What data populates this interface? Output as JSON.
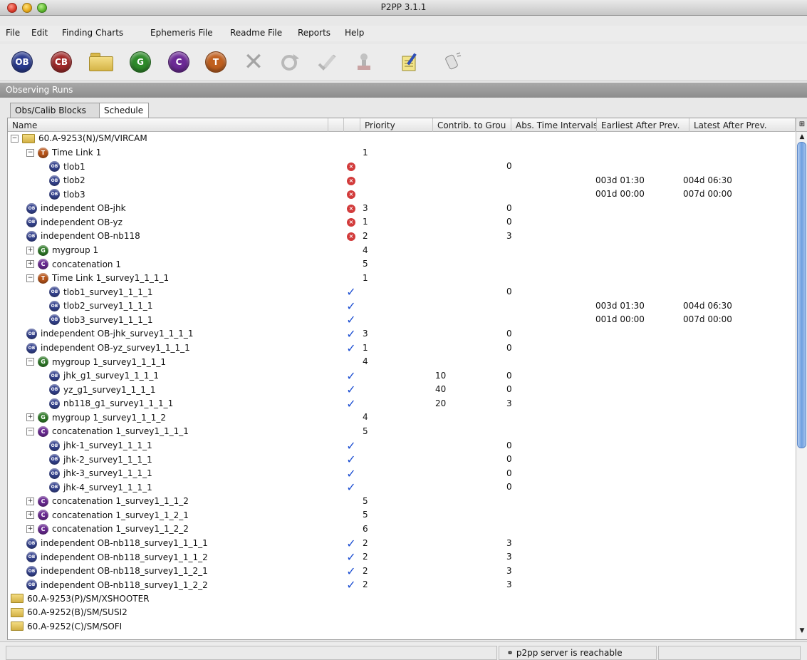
{
  "window": {
    "title": "P2PP 3.1.1"
  },
  "menu": [
    "File",
    "Edit",
    "Finding Charts",
    "Ephemeris File",
    "Readme File",
    "Reports",
    "Help"
  ],
  "toolbar": {
    "ob_label": "OB",
    "cb_label": "CB",
    "g_label": "G",
    "c_label": "C",
    "t_label": "T"
  },
  "panel": {
    "title": "Observing Runs"
  },
  "tabs": [
    "Obs/Calib Blocks",
    "Schedule"
  ],
  "columns": [
    "Name",
    "Priority",
    "Contrib. to Grou",
    "Abs. Time Intervals",
    "Earliest After Prev.",
    "Latest After Prev."
  ],
  "icon_badges": {
    "ob": "OB",
    "t": "T",
    "g": "G",
    "c": "C"
  },
  "status_glyphs": {
    "error": "×",
    "ok": "✓"
  },
  "rows": [
    {
      "depth": 0,
      "exp": "-",
      "icon": "folder",
      "name": "60.A-9253(N)/SM/VIRCAM",
      "status": "",
      "prio": "",
      "contrib": "",
      "abs": "",
      "earliest": "",
      "latest": ""
    },
    {
      "depth": 1,
      "exp": "-",
      "icon": "t",
      "name": "Time Link 1",
      "status": "",
      "prio": "1",
      "contrib": "",
      "abs": "",
      "earliest": "",
      "latest": ""
    },
    {
      "depth": 2,
      "exp": "",
      "icon": "ob",
      "name": "tlob1",
      "status": "error",
      "prio": "",
      "contrib": "",
      "abs": "0",
      "earliest": "",
      "latest": ""
    },
    {
      "depth": 2,
      "exp": "",
      "icon": "ob",
      "name": "tlob2",
      "status": "error",
      "prio": "",
      "contrib": "",
      "abs": "",
      "earliest": "003d 01:30",
      "latest": "004d 06:30"
    },
    {
      "depth": 2,
      "exp": "",
      "icon": "ob",
      "name": "tlob3",
      "status": "error",
      "prio": "",
      "contrib": "",
      "abs": "",
      "earliest": "001d 00:00",
      "latest": "007d 00:00"
    },
    {
      "depth": 1,
      "exp": "",
      "icon": "ob",
      "name": "independent OB-jhk",
      "status": "error",
      "prio": "3",
      "contrib": "",
      "abs": "0",
      "earliest": "",
      "latest": ""
    },
    {
      "depth": 1,
      "exp": "",
      "icon": "ob",
      "name": "independent OB-yz",
      "status": "error",
      "prio": "1",
      "contrib": "",
      "abs": "0",
      "earliest": "",
      "latest": ""
    },
    {
      "depth": 1,
      "exp": "",
      "icon": "ob",
      "name": "independent OB-nb118",
      "status": "error",
      "prio": "2",
      "contrib": "",
      "abs": "3",
      "earliest": "",
      "latest": ""
    },
    {
      "depth": 1,
      "exp": "+",
      "icon": "g",
      "name": "mygroup 1",
      "status": "",
      "prio": "4",
      "contrib": "",
      "abs": "",
      "earliest": "",
      "latest": ""
    },
    {
      "depth": 1,
      "exp": "+",
      "icon": "c",
      "name": "concatenation 1",
      "status": "",
      "prio": "5",
      "contrib": "",
      "abs": "",
      "earliest": "",
      "latest": ""
    },
    {
      "depth": 1,
      "exp": "-",
      "icon": "t",
      "name": "Time Link 1_survey1_1_1_1",
      "status": "",
      "prio": "1",
      "contrib": "",
      "abs": "",
      "earliest": "",
      "latest": ""
    },
    {
      "depth": 2,
      "exp": "",
      "icon": "ob",
      "name": "tlob1_survey1_1_1_1",
      "status": "ok",
      "prio": "",
      "contrib": "",
      "abs": "0",
      "earliest": "",
      "latest": ""
    },
    {
      "depth": 2,
      "exp": "",
      "icon": "ob",
      "name": "tlob2_survey1_1_1_1",
      "status": "ok",
      "prio": "",
      "contrib": "",
      "abs": "",
      "earliest": "003d 01:30",
      "latest": "004d 06:30"
    },
    {
      "depth": 2,
      "exp": "",
      "icon": "ob",
      "name": "tlob3_survey1_1_1_1",
      "status": "ok",
      "prio": "",
      "contrib": "",
      "abs": "",
      "earliest": "001d 00:00",
      "latest": "007d 00:00"
    },
    {
      "depth": 1,
      "exp": "",
      "icon": "ob",
      "name": "independent OB-jhk_survey1_1_1_1",
      "status": "ok",
      "prio": "3",
      "contrib": "",
      "abs": "0",
      "earliest": "",
      "latest": ""
    },
    {
      "depth": 1,
      "exp": "",
      "icon": "ob",
      "name": "independent OB-yz_survey1_1_1_1",
      "status": "ok",
      "prio": "1",
      "contrib": "",
      "abs": "0",
      "earliest": "",
      "latest": ""
    },
    {
      "depth": 1,
      "exp": "-",
      "icon": "g",
      "name": "mygroup 1_survey1_1_1_1",
      "status": "",
      "prio": "4",
      "contrib": "",
      "abs": "",
      "earliest": "",
      "latest": ""
    },
    {
      "depth": 2,
      "exp": "",
      "icon": "ob",
      "name": "jhk_g1_survey1_1_1_1",
      "status": "ok",
      "prio": "",
      "contrib": "10",
      "abs": "0",
      "earliest": "",
      "latest": ""
    },
    {
      "depth": 2,
      "exp": "",
      "icon": "ob",
      "name": "yz_g1_survey1_1_1_1",
      "status": "ok",
      "prio": "",
      "contrib": "40",
      "abs": "0",
      "earliest": "",
      "latest": ""
    },
    {
      "depth": 2,
      "exp": "",
      "icon": "ob",
      "name": "nb118_g1_survey1_1_1_1",
      "status": "ok",
      "prio": "",
      "contrib": "20",
      "abs": "3",
      "earliest": "",
      "latest": ""
    },
    {
      "depth": 1,
      "exp": "+",
      "icon": "g",
      "name": "mygroup 1_survey1_1_1_2",
      "status": "",
      "prio": "4",
      "contrib": "",
      "abs": "",
      "earliest": "",
      "latest": ""
    },
    {
      "depth": 1,
      "exp": "-",
      "icon": "c",
      "name": "concatenation 1_survey1_1_1_1",
      "status": "",
      "prio": "5",
      "contrib": "",
      "abs": "",
      "earliest": "",
      "latest": ""
    },
    {
      "depth": 2,
      "exp": "",
      "icon": "ob",
      "name": "jhk-1_survey1_1_1_1",
      "status": "ok",
      "prio": "",
      "contrib": "",
      "abs": "0",
      "earliest": "",
      "latest": ""
    },
    {
      "depth": 2,
      "exp": "",
      "icon": "ob",
      "name": "jhk-2_survey1_1_1_1",
      "status": "ok",
      "prio": "",
      "contrib": "",
      "abs": "0",
      "earliest": "",
      "latest": ""
    },
    {
      "depth": 2,
      "exp": "",
      "icon": "ob",
      "name": "jhk-3_survey1_1_1_1",
      "status": "ok",
      "prio": "",
      "contrib": "",
      "abs": "0",
      "earliest": "",
      "latest": ""
    },
    {
      "depth": 2,
      "exp": "",
      "icon": "ob",
      "name": "jhk-4_survey1_1_1_1",
      "status": "ok",
      "prio": "",
      "contrib": "",
      "abs": "0",
      "earliest": "",
      "latest": ""
    },
    {
      "depth": 1,
      "exp": "+",
      "icon": "c",
      "name": "concatenation 1_survey1_1_1_2",
      "status": "",
      "prio": "5",
      "contrib": "",
      "abs": "",
      "earliest": "",
      "latest": ""
    },
    {
      "depth": 1,
      "exp": "+",
      "icon": "c",
      "name": "concatenation 1_survey1_1_2_1",
      "status": "",
      "prio": "5",
      "contrib": "",
      "abs": "",
      "earliest": "",
      "latest": ""
    },
    {
      "depth": 1,
      "exp": "+",
      "icon": "c",
      "name": "concatenation 1_survey1_1_2_2",
      "status": "",
      "prio": "6",
      "contrib": "",
      "abs": "",
      "earliest": "",
      "latest": ""
    },
    {
      "depth": 1,
      "exp": "",
      "icon": "ob",
      "name": "independent OB-nb118_survey1_1_1_1",
      "status": "ok",
      "prio": "2",
      "contrib": "",
      "abs": "3",
      "earliest": "",
      "latest": ""
    },
    {
      "depth": 1,
      "exp": "",
      "icon": "ob",
      "name": "independent OB-nb118_survey1_1_1_2",
      "status": "ok",
      "prio": "2",
      "contrib": "",
      "abs": "3",
      "earliest": "",
      "latest": ""
    },
    {
      "depth": 1,
      "exp": "",
      "icon": "ob",
      "name": "independent OB-nb118_survey1_1_2_1",
      "status": "ok",
      "prio": "2",
      "contrib": "",
      "abs": "3",
      "earliest": "",
      "latest": ""
    },
    {
      "depth": 1,
      "exp": "",
      "icon": "ob",
      "name": "independent OB-nb118_survey1_1_2_2",
      "status": "ok",
      "prio": "2",
      "contrib": "",
      "abs": "3",
      "earliest": "",
      "latest": ""
    },
    {
      "depth": 0,
      "exp": "",
      "icon": "folder",
      "name": "60.A-9253(P)/SM/XSHOOTER",
      "status": "",
      "prio": "",
      "contrib": "",
      "abs": "",
      "earliest": "",
      "latest": ""
    },
    {
      "depth": 0,
      "exp": "",
      "icon": "folder",
      "name": "60.A-9252(B)/SM/SUSI2",
      "status": "",
      "prio": "",
      "contrib": "",
      "abs": "",
      "earliest": "",
      "latest": ""
    },
    {
      "depth": 0,
      "exp": "",
      "icon": "folder",
      "name": "60.A-9252(C)/SM/SOFI",
      "status": "",
      "prio": "",
      "contrib": "",
      "abs": "",
      "earliest": "",
      "latest": ""
    }
  ],
  "statusbar": {
    "message": "p2pp server is reachable"
  }
}
